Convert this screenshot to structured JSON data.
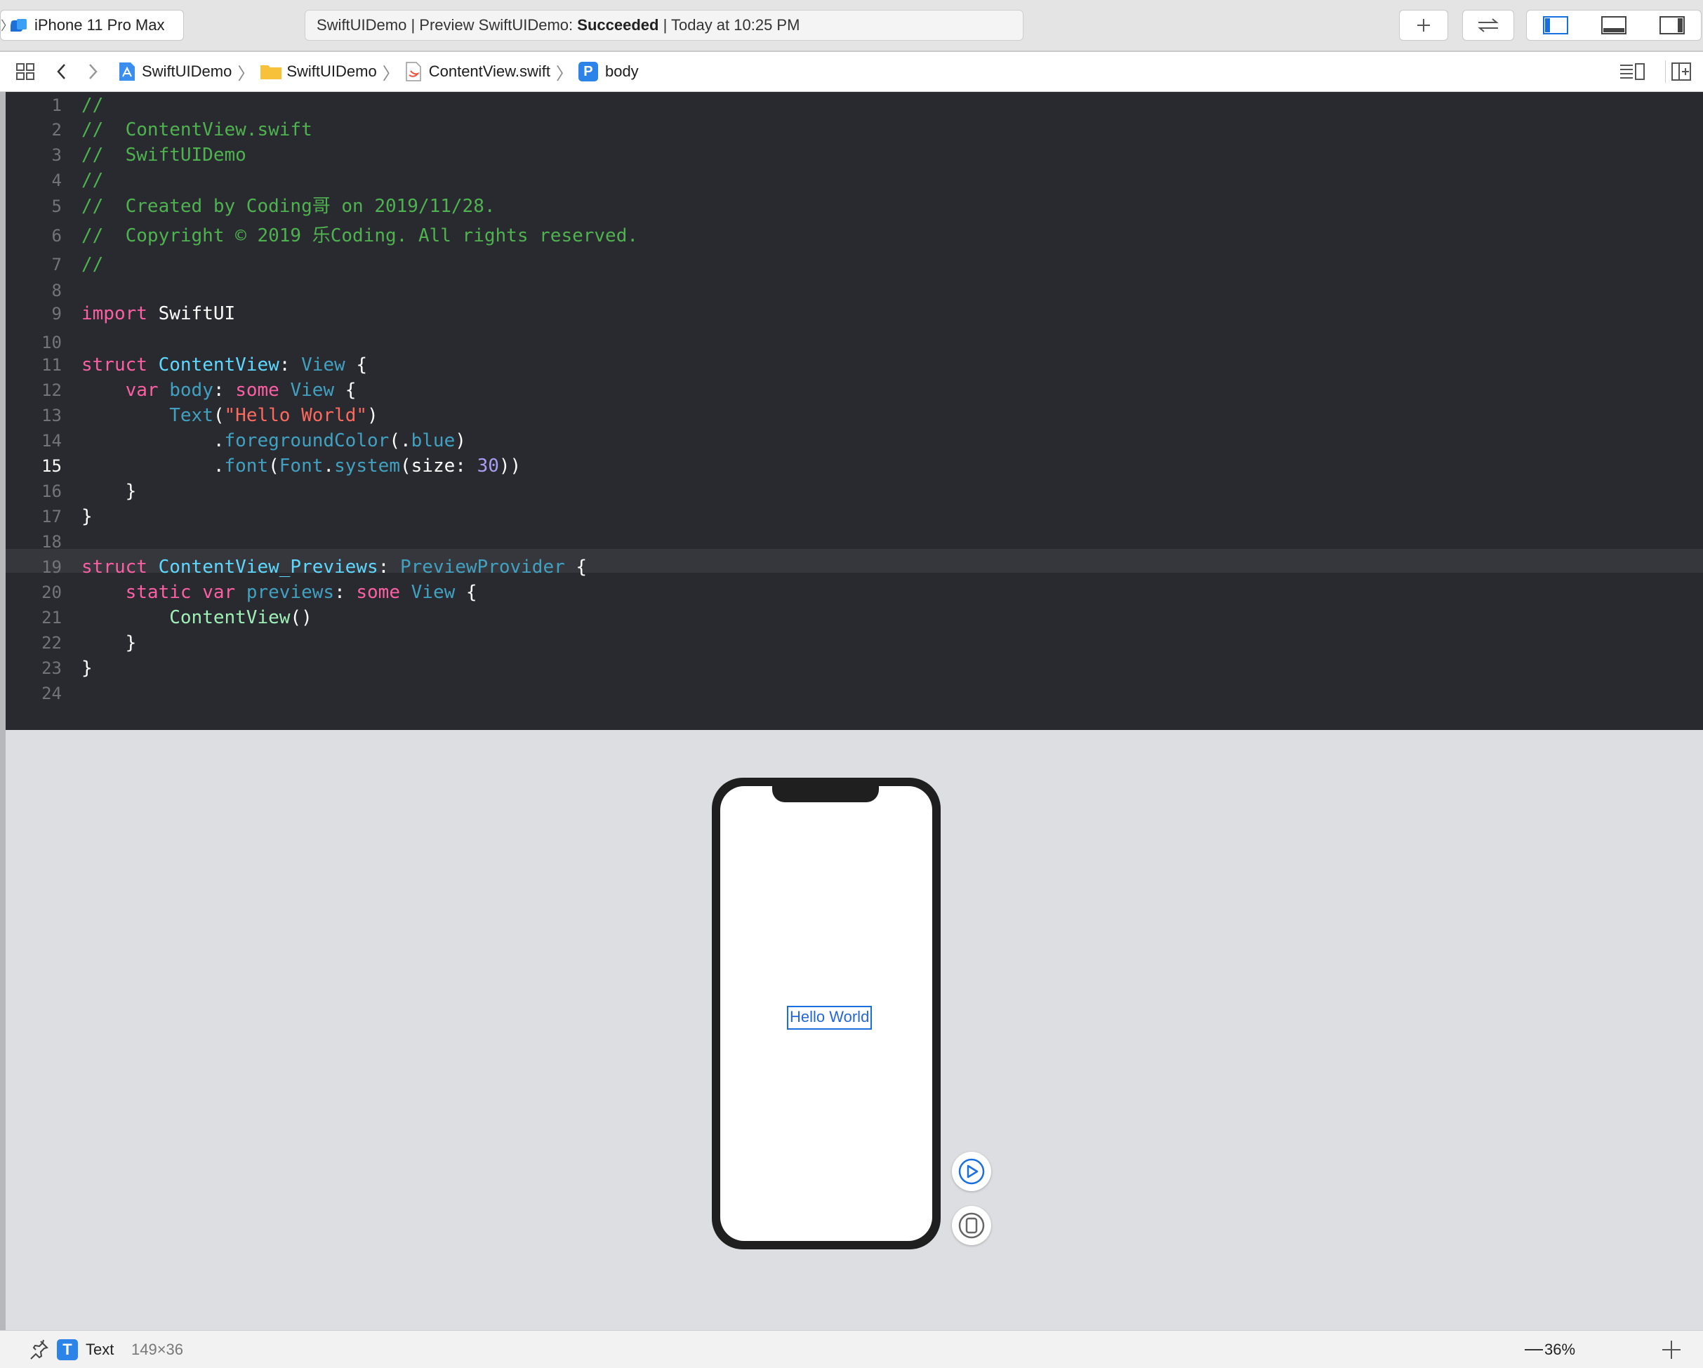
{
  "toolbar": {
    "scheme": "iPhone 11 Pro Max",
    "activity_prefix": "SwiftUIDemo | Preview SwiftUIDemo:",
    "activity_status": "Succeeded",
    "activity_suffix": "| Today at 10:25 PM",
    "icons": [
      "add-icon",
      "swap-arrows-icon",
      "navigator-panel-icon",
      "debug-area-icon",
      "inspector-panel-icon"
    ]
  },
  "jumpbar": {
    "icons": [
      "grid-icon",
      "back-chevron-icon",
      "forward-chevron-icon",
      "editor-options-icon",
      "add-editor-icon"
    ],
    "crumbs": [
      {
        "label": "SwiftUIDemo",
        "icon": "project-icon"
      },
      {
        "label": "SwiftUIDemo",
        "icon": "folder-icon"
      },
      {
        "label": "ContentView.swift",
        "icon": "swift-file-icon"
      },
      {
        "label": "body",
        "icon": "property-icon",
        "badge": "P"
      }
    ]
  },
  "editor": {
    "current_line": 15,
    "line_numbers": [
      "1",
      "2",
      "3",
      "4",
      "5",
      "6",
      "7",
      "8",
      "9",
      "10",
      "11",
      "12",
      "13",
      "14",
      "15",
      "16",
      "17",
      "18",
      "19",
      "20",
      "21",
      "22",
      "23",
      "24"
    ],
    "lines": {
      "l1": "//",
      "l2": "//  ContentView.swift",
      "l3": "//  SwiftUIDemo",
      "l4": "//",
      "l5": "//  Created by Coding哥 on 2019/11/28.",
      "l6": "//  Copyright © 2019 乐Coding. All rights reserved.",
      "l7": "//",
      "l9_kw": "import",
      "l9_name": " SwiftUI",
      "l11_kw": "struct",
      "l11_name": " ContentView",
      "l11_colon": ": ",
      "l11_type": "View",
      "l11_brace": " {",
      "l12_kw": "var",
      "l12_name": " body",
      "l12_colon": ": ",
      "l12_kw2": "some",
      "l12_type": " View",
      "l12_brace": " {",
      "l13_fn": "Text",
      "l13_p1": "(",
      "l13_str": "\"Hello World\"",
      "l13_p2": ")",
      "l14_dot": ".",
      "l14_fn": "foregroundColor",
      "l14_p1": "(.",
      "l14_arg": "blue",
      "l14_p2": ")",
      "l15_dot": ".",
      "l15_fn": "font",
      "l15_p1": "(",
      "l15_type": "Font",
      "l15_dot2": ".",
      "l15_fn2": "system",
      "l15_p2": "(size: ",
      "l15_num": "30",
      "l15_p3": "))",
      "l16": "}",
      "l17": "}",
      "l19_kw": "struct",
      "l19_name": " ContentView_Previews",
      "l19_colon": ": ",
      "l19_type": "PreviewProvider",
      "l19_brace": " {",
      "l20_kw": "static",
      "l20_kw2": " var",
      "l20_name": " previews",
      "l20_colon": ": ",
      "l20_kw3": "some",
      "l20_type": " View",
      "l20_brace": " {",
      "l21_fn": "ContentView",
      "l21_p": "()",
      "l22": "}",
      "l23": "}"
    }
  },
  "preview": {
    "device_text": "Hello World",
    "text_color": "#2468d8",
    "buttons": [
      "live-preview-play-icon",
      "preview-on-device-icon"
    ]
  },
  "bottombar": {
    "element_type": "Text",
    "element_badge": "T",
    "element_size": "149×36",
    "zoom": "36%"
  }
}
